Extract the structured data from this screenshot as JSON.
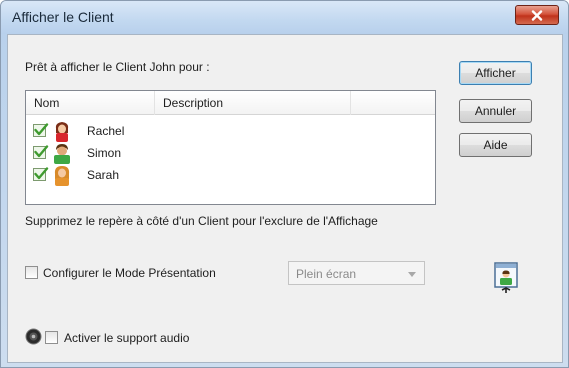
{
  "window": {
    "title": "Afficher le Client"
  },
  "dialog": {
    "prompt": "Prêt à afficher le Client John pour :",
    "hint": "Supprimez le repère à côté d'un Client pour l'exclure de l'Affichage"
  },
  "listview": {
    "columns": [
      "Nom",
      "Description",
      ""
    ],
    "rows": [
      {
        "name": "Rachel",
        "description": "",
        "checked": true,
        "avatar": "female-student-red"
      },
      {
        "name": "Simon",
        "description": "",
        "checked": true,
        "avatar": "male-student-green"
      },
      {
        "name": "Sarah",
        "description": "",
        "checked": true,
        "avatar": "female-student-orange"
      }
    ]
  },
  "buttons": {
    "show": "Afficher",
    "cancel": "Annuler",
    "help": "Aide"
  },
  "presentation": {
    "label": "Configurer le Mode Présentation",
    "checked": false,
    "mode_value": "Plein écran",
    "icon": "presentation-screen-icon"
  },
  "audio": {
    "label": "Activer le support audio",
    "checked": false,
    "icon": "speaker-icon"
  },
  "colors": {
    "close": "#c0321b",
    "title_bg": "#c2d8f0",
    "check": "#4aa83a"
  }
}
